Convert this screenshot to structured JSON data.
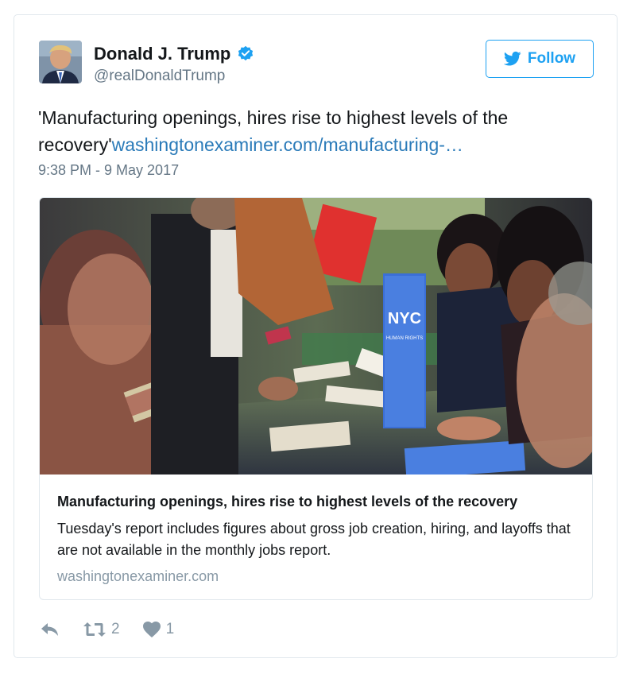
{
  "user": {
    "name": "Donald J. Trump",
    "handle": "@realDonaldTrump",
    "verified": true
  },
  "follow_button": {
    "label": "Follow",
    "icon": "twitter-bird-icon"
  },
  "tweet": {
    "text": "'Manufacturing openings, hires rise to highest levels of the recovery'",
    "link_text": "washingtonexaminer.com/manufacturing-…",
    "timestamp": "9:38 PM - 9 May 2017"
  },
  "card": {
    "image_icon": "job-fair-photo",
    "title": "Manufacturing openings, hires rise to highest levels of the recovery",
    "description": "Tuesday's report includes figures about gross job creation, hiring, and layoffs that are not available in the monthly jobs report.",
    "domain": "washingtonexaminer.com",
    "photo_banner_text": "NYC",
    "photo_banner_subtext": "HUMAN RIGHTS"
  },
  "actions": {
    "reply": {
      "icon": "reply-icon"
    },
    "retweet": {
      "icon": "retweet-icon",
      "count": "2"
    },
    "like": {
      "icon": "heart-icon",
      "count": "1"
    }
  },
  "colors": {
    "brand_blue": "#1da1f2",
    "link_blue": "#2b7bb9",
    "muted_gray": "#657786",
    "border": "#e1e8ed"
  }
}
